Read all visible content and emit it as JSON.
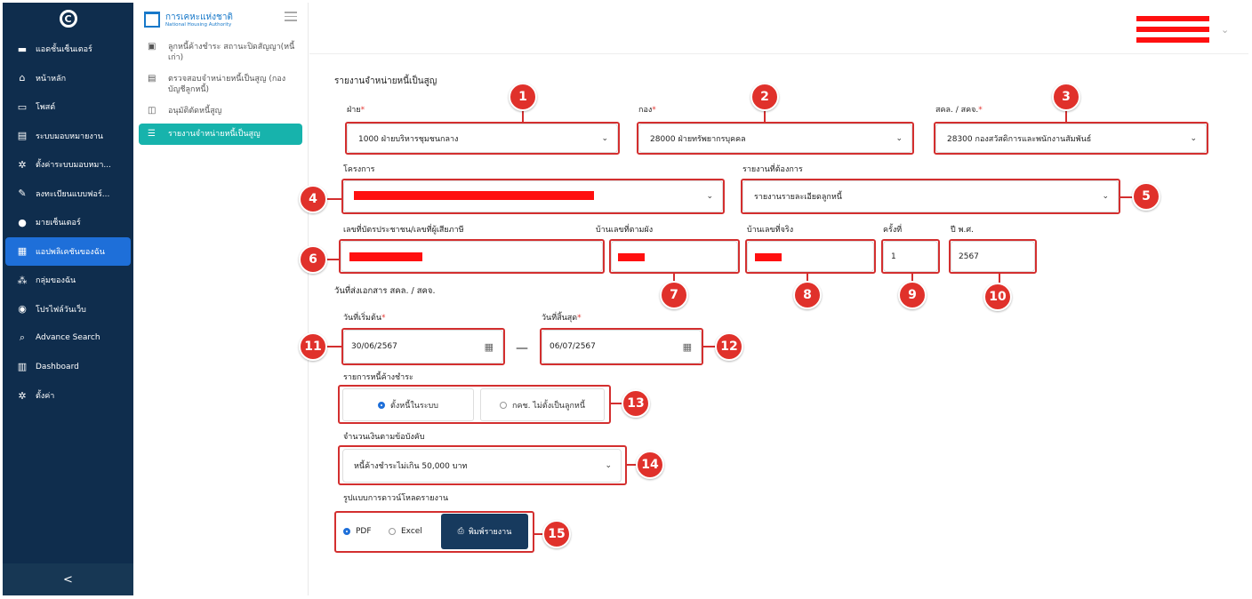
{
  "nav": {
    "items": [
      {
        "label": "แอดชั้นเซ็นเตอร์",
        "icon": "briefcase-icon"
      },
      {
        "label": "หน้าหลัก",
        "icon": "home-icon"
      },
      {
        "label": "โพสต์",
        "icon": "post-icon"
      },
      {
        "label": "ระบบมอบหมายงาน",
        "icon": "document-icon"
      },
      {
        "label": "ตั้งค่าระบบมอบหมา...",
        "icon": "gear-icon"
      },
      {
        "label": "ลงทะเบียนแบบฟอร์...",
        "icon": "form-icon"
      },
      {
        "label": "มายเซ็นเตอร์",
        "icon": "user-icon"
      },
      {
        "label": "แอปพลิเคชันของฉัน",
        "icon": "apps-icon"
      },
      {
        "label": "กลุ่มของฉัน",
        "icon": "group-icon"
      },
      {
        "label": "โปรไฟล์วันเว็บ",
        "icon": "profile-icon"
      },
      {
        "label": "Advance Search",
        "icon": "search-icon"
      },
      {
        "label": "Dashboard",
        "icon": "chart-icon"
      },
      {
        "label": "ตั้งค่า",
        "icon": "settings-icon"
      }
    ],
    "active_index": 7,
    "collapse_label": "<"
  },
  "brand": {
    "name_th": "การเคหะแห่งชาติ",
    "name_en": "National Housing Authority"
  },
  "sub_menu": [
    {
      "label": "ลูกหนี้ค้างชำระ สถานะปิดสัญญา(หนี้เก่า)",
      "icon": "calendar-icon"
    },
    {
      "label": "ตรวจสอบจำหน่ายหนี้เป็นสูญ (กองบัญชีลูกหนี้)",
      "icon": "document-icon"
    },
    {
      "label": "อนุมัติตัดหนี้สูญ",
      "icon": "check-doc-icon"
    },
    {
      "label": "รายงานจำหน่ายหนี้เป็นสูญ",
      "icon": "list-icon"
    }
  ],
  "form": {
    "title": "รายงานจำหน่ายหนี้เป็นสูญ",
    "fay": {
      "label": "ฝ่าย",
      "value": "1000 ฝ่ายบริหารชุมชนกลาง"
    },
    "kong": {
      "label": "กอง",
      "value": "28000 ฝ่ายทรัพยากรบุคคล"
    },
    "sakol": {
      "label": "สคล. / สคจ.",
      "value": "28300 กองสวัสดิการและพนักงานสัมพันธ์"
    },
    "project": {
      "label": "โครงการ",
      "value": ""
    },
    "report_type": {
      "label": "รายงานที่ต้องการ",
      "value": "รายงานรายละเอียดลูกหนี้"
    },
    "id_card": {
      "label": "เลขที่บัตรประชาชน/เลขที่ผู้เสียภาษี"
    },
    "house_plan": {
      "label": "บ้านเลขที่ตามผัง"
    },
    "house_real": {
      "label": "บ้านเลขที่จริง"
    },
    "round": {
      "label": "ครั้งที่",
      "value": "1"
    },
    "year": {
      "label": "ปี พ.ศ.",
      "value": "2567"
    },
    "send_date_title": "วันที่ส่งเอกสาร สคล. / สคจ.",
    "start_date": {
      "label": "วันที่เริ่มต้น",
      "value": "30/06/2567"
    },
    "end_date": {
      "label": "วันที่สิ้นสุด",
      "value": "06/07/2567"
    },
    "date_dash": "—",
    "debt_list": {
      "label": "รายการหนี้ค้างชำระ",
      "option1": "ตั้งหนี้ในระบบ",
      "option2": "กคช. ไม่ตั้งเป็นลูกหนี้"
    },
    "amount": {
      "label": "จำนวนเงินตามข้อบังคับ",
      "value": "หนี้ค้างชำระไม่เกิน 50,000 บาท"
    },
    "download": {
      "label": "รูปแบบการดาวน์โหลดรายงาน",
      "pdf": "PDF",
      "excel": "Excel",
      "print": "พิมพ์รายงาน"
    }
  },
  "badges": [
    "1",
    "2",
    "3",
    "4",
    "5",
    "6",
    "7",
    "8",
    "9",
    "10",
    "11",
    "12",
    "13",
    "14",
    "15"
  ],
  "colors": {
    "nav_bg": "#0f2d4d",
    "active_nav": "#1e6fd9",
    "active_sub": "#17b3ac",
    "highlight": "#d32f2f",
    "redact": "#ff1010"
  }
}
